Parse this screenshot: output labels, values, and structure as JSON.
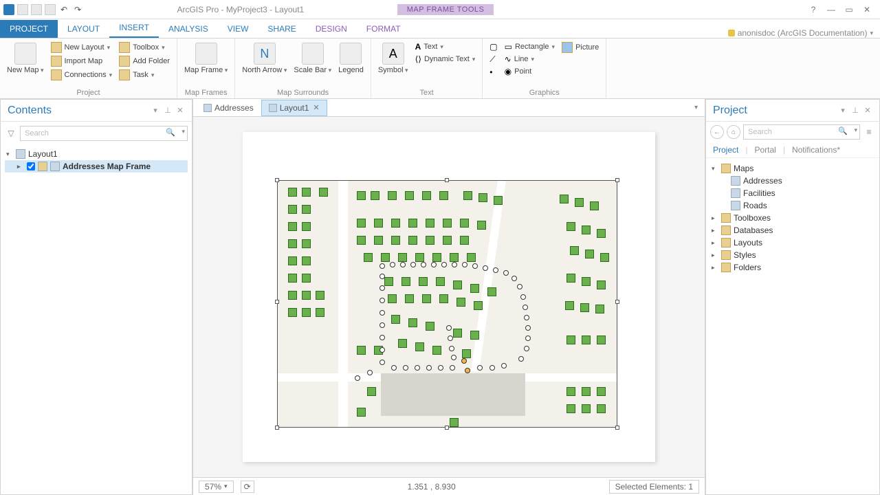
{
  "titlebar": {
    "title": "ArcGIS Pro - MyProject3 - Layout1",
    "contextual_tab": "MAP FRAME TOOLS",
    "help_icon": "?",
    "min_icon": "—",
    "max_icon": "▭",
    "close_icon": "✕"
  },
  "signin": "anonisdoc (ArcGIS Documentation)",
  "ribbon_tabs": [
    "PROJECT",
    "LAYOUT",
    "INSERT",
    "ANALYSIS",
    "VIEW",
    "SHARE",
    "DESIGN",
    "FORMAT"
  ],
  "ribbon": {
    "project": {
      "label": "Project",
      "new_map": "New\nMap",
      "new_layout": "New Layout",
      "import_map": "Import Map",
      "connections": "Connections",
      "toolbox": "Toolbox",
      "add_folder": "Add Folder",
      "task": "Task"
    },
    "map_frames": {
      "label": "Map Frames",
      "map_frame": "Map\nFrame"
    },
    "map_surrounds": {
      "label": "Map Surrounds",
      "north_arrow": "North\nArrow",
      "scale_bar": "Scale\nBar",
      "legend": "Legend"
    },
    "text": {
      "label": "Text",
      "symbol": "Symbol",
      "text": "Text",
      "dynamic_text": "Dynamic Text"
    },
    "graphics": {
      "label": "Graphics",
      "rectangle": "Rectangle",
      "line": "Line",
      "point": "Point",
      "picture": "Picture"
    }
  },
  "contents_panel": {
    "title": "Contents",
    "search_placeholder": "Search",
    "layout_node": "Layout1",
    "map_frame_node": "Addresses Map Frame"
  },
  "view_tabs": {
    "tab1": "Addresses",
    "tab2": "Layout1"
  },
  "status": {
    "zoom": "57%",
    "coords": "1.351 , 8.930",
    "selected": "Selected Elements: 1"
  },
  "project_panel": {
    "title": "Project",
    "search_placeholder": "Search",
    "tabs": [
      "Project",
      "Portal",
      "Notifications*"
    ],
    "maps": "Maps",
    "maps_children": [
      "Addresses",
      "Facilities",
      "Roads"
    ],
    "folders": [
      "Toolboxes",
      "Databases",
      "Layouts",
      "Styles",
      "Folders"
    ]
  }
}
